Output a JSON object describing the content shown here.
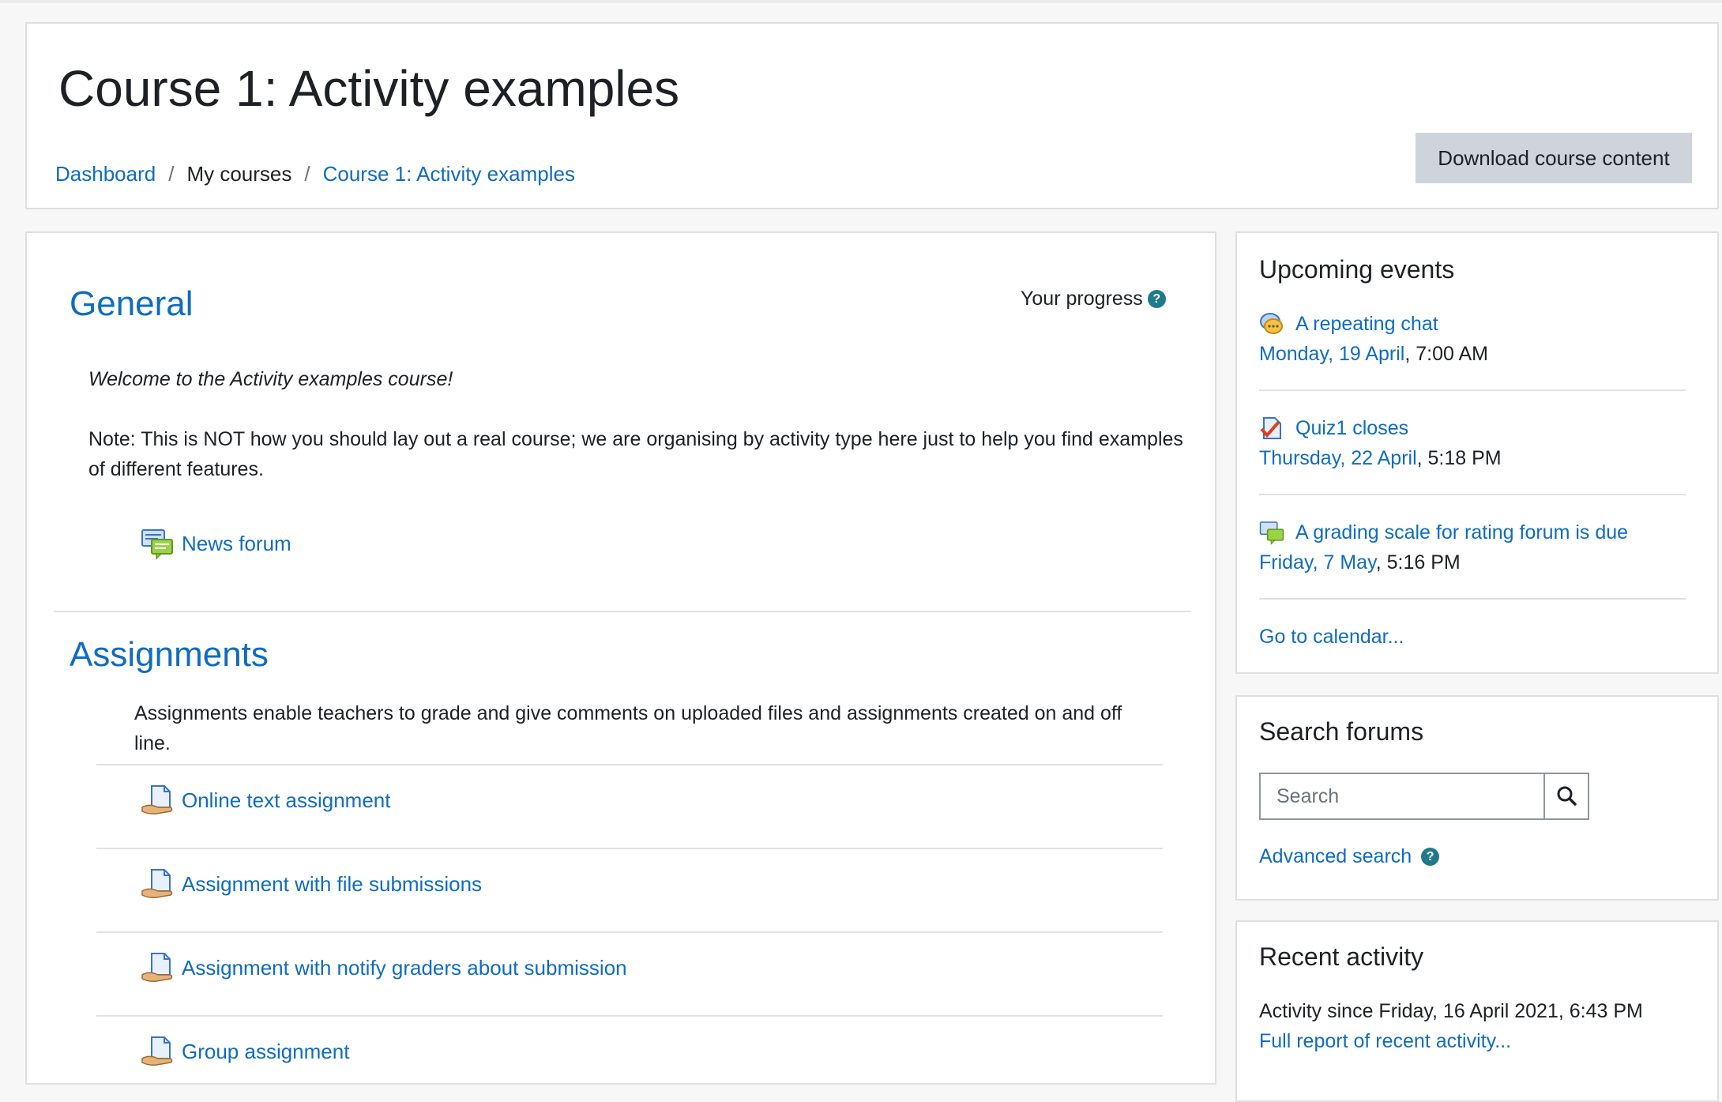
{
  "header": {
    "title": "Course 1: Activity examples",
    "breadcrumb": [
      "Dashboard",
      "My courses",
      "Course 1: Activity examples"
    ],
    "download_label": "Download course content"
  },
  "main": {
    "general": {
      "title": "General",
      "progress_label": "Your progress",
      "welcome": "Welcome to the Activity examples course!",
      "note": "Note: This is NOT how you should lay out a real course; we are organising by activity type here just to help you find examples of different features.",
      "activities": [
        {
          "label": "News forum",
          "icon": "forum-icon"
        }
      ]
    },
    "assignments": {
      "title": "Assignments",
      "summary": "Assignments enable teachers to grade and give comments on uploaded files and assignments created on and off line.",
      "activities": [
        {
          "label": "Online text assignment",
          "icon": "assignment-icon"
        },
        {
          "label": "Assignment with file submissions",
          "icon": "assignment-icon"
        },
        {
          "label": "Assignment with notify graders about submission",
          "icon": "assignment-icon"
        },
        {
          "label": "Group assignment",
          "icon": "assignment-icon"
        }
      ]
    }
  },
  "upcoming": {
    "title": "Upcoming events",
    "events": [
      {
        "name": "A repeating chat",
        "date": "Monday, 19 April",
        "time": ", 7:00 AM",
        "icon": "chat-icon"
      },
      {
        "name": "Quiz1 closes",
        "date": "Thursday, 22 April",
        "time": ", 5:18 PM",
        "icon": "quiz-icon"
      },
      {
        "name": "A grading scale for rating forum is due",
        "date": "Friday, 7 May",
        "time": ", 5:16 PM",
        "icon": "forum-icon"
      }
    ],
    "calendar_link": "Go to calendar..."
  },
  "search_forums": {
    "title": "Search forums",
    "placeholder": "Search",
    "advanced": "Advanced search"
  },
  "recent": {
    "title": "Recent activity",
    "since": "Activity since Friday, 16 April 2021, 6:43 PM",
    "full_report": "Full report of recent activity..."
  },
  "colors": {
    "link": "#0f6cbf",
    "button_bg": "#ced4da",
    "help_icon": "#1f7a8c"
  }
}
